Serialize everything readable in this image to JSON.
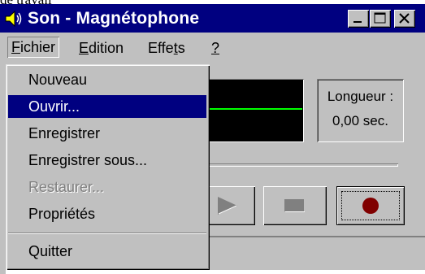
{
  "document": {
    "caption": "de travail"
  },
  "window": {
    "title": "Son - Magnétophone",
    "icon": "speaker-icon",
    "controls": [
      "minimize-icon",
      "maximize-icon",
      "close-icon"
    ]
  },
  "menubar": {
    "items": [
      {
        "label": "Fichier",
        "active": true
      },
      {
        "label": "Edition",
        "active": false
      },
      {
        "label": "Effets",
        "active": false
      },
      {
        "label": "?",
        "active": false
      }
    ]
  },
  "file_menu": {
    "items": [
      {
        "label": "Nouveau",
        "state": "normal"
      },
      {
        "label": "Ouvrir...",
        "state": "selected"
      },
      {
        "label": "Enregistrer",
        "state": "normal"
      },
      {
        "label": "Enregistrer sous...",
        "state": "normal"
      },
      {
        "label": "Restaurer...",
        "state": "disabled"
      },
      {
        "label": "Propriétés",
        "state": "normal"
      },
      {
        "label": "Quitter",
        "state": "normal"
      }
    ]
  },
  "recorder": {
    "length_label": "Longueur :",
    "length_value": "0,00 sec.",
    "buttons": [
      "play-icon",
      "stop-icon",
      "record-icon"
    ],
    "record_color": "#800000",
    "waveform_color": "#00ff00"
  },
  "colors": {
    "titlebar": "#000080",
    "selection": "#000080",
    "face": "#c0c0c0"
  }
}
